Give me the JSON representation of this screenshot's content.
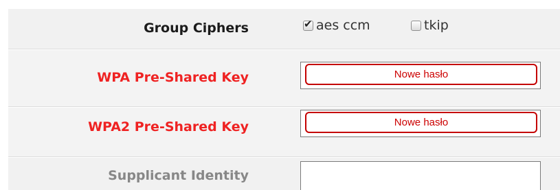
{
  "group_ciphers": {
    "label": "Group Ciphers",
    "options": [
      {
        "label": "aes ccm",
        "checked": true
      },
      {
        "label": "tkip",
        "checked": false
      }
    ]
  },
  "wpa_psk": {
    "label": "WPA Pre-Shared Key",
    "annotation": "Nowe hasło"
  },
  "wpa2_psk": {
    "label": "WPA2 Pre-Shared Key",
    "annotation": "Nowe hasło"
  },
  "supplicant_identity": {
    "label": "Supplicant Identity",
    "value": ""
  },
  "icons": {
    "checked_mark": "checkmark-icon"
  },
  "colors": {
    "label_dark": "#1b1b1b",
    "label_red": "#ef2222",
    "label_gray": "#878787",
    "annotation_border": "#c40000",
    "annotation_text": "#cc0000",
    "row_bg": "#f1f1f1"
  }
}
